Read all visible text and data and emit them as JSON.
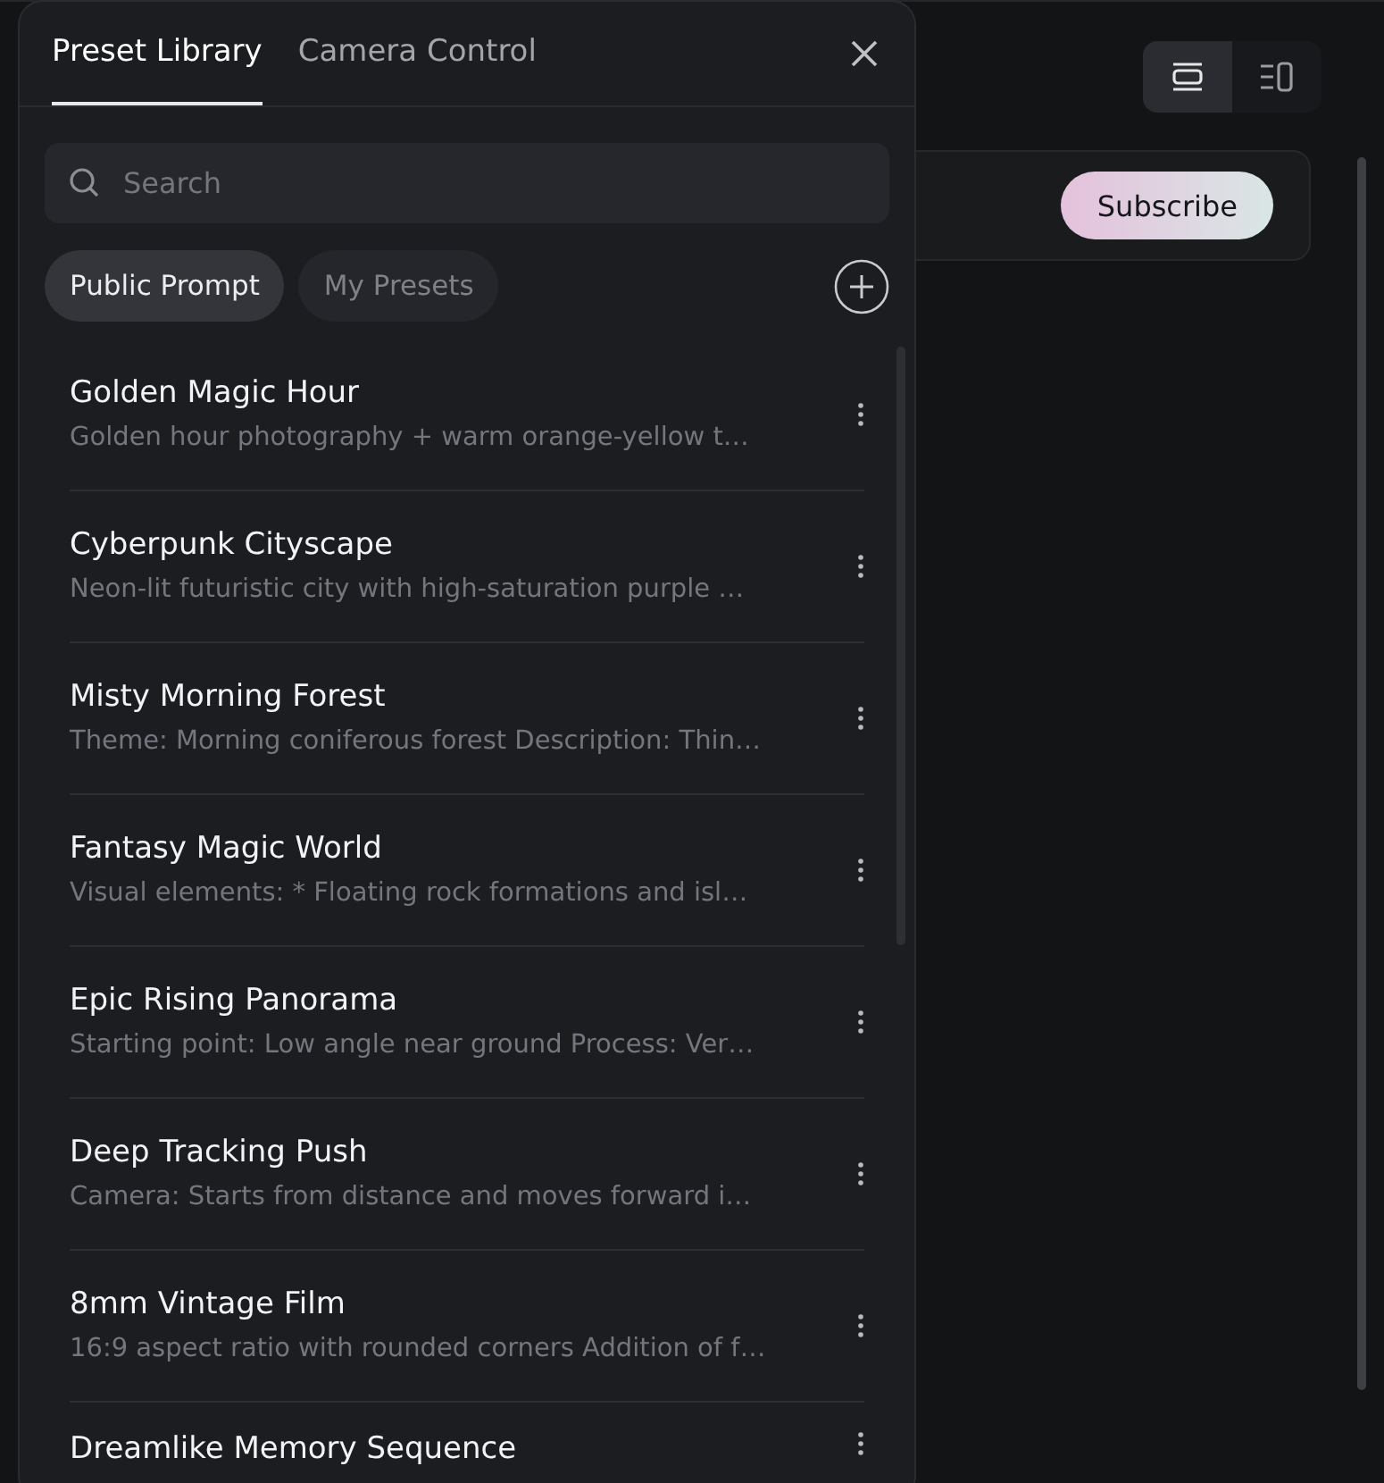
{
  "background": {
    "view_toggle": [
      {
        "kind": "stacked",
        "selected": true
      },
      {
        "kind": "sidebar",
        "selected": false
      }
    ],
    "subscribe_button": "Subscribe"
  },
  "preset_panel": {
    "tabs": [
      {
        "label": "Preset Library",
        "selected": true
      },
      {
        "label": "Camera Control",
        "selected": false
      }
    ],
    "search": {
      "placeholder": "Search"
    },
    "filters": [
      {
        "label": "Public Prompt",
        "selected": true
      },
      {
        "label": "My Presets",
        "selected": false
      }
    ],
    "presets": [
      {
        "title": "Golden Magic Hour",
        "description": "Golden hour photography + warm orange-yellow t…"
      },
      {
        "title": "Cyberpunk Cityscape",
        "description": "Neon-lit futuristic city with high-saturation purple …"
      },
      {
        "title": "Misty Morning Forest",
        "description": "Theme: Morning coniferous forest Description: Thin…"
      },
      {
        "title": "Fantasy Magic World",
        "description": "Visual elements: * Floating rock formations and isl…"
      },
      {
        "title": "Epic Rising Panorama",
        "description": "Starting point: Low angle near ground Process: Ver…"
      },
      {
        "title": "Deep Tracking Push",
        "description": "Camera: Starts from distance and moves forward i…"
      },
      {
        "title": "8mm Vintage Film",
        "description": "16:9 aspect ratio with rounded corners Addition of f…"
      },
      {
        "title": "Dreamlike Memory Sequence"
      }
    ]
  }
}
